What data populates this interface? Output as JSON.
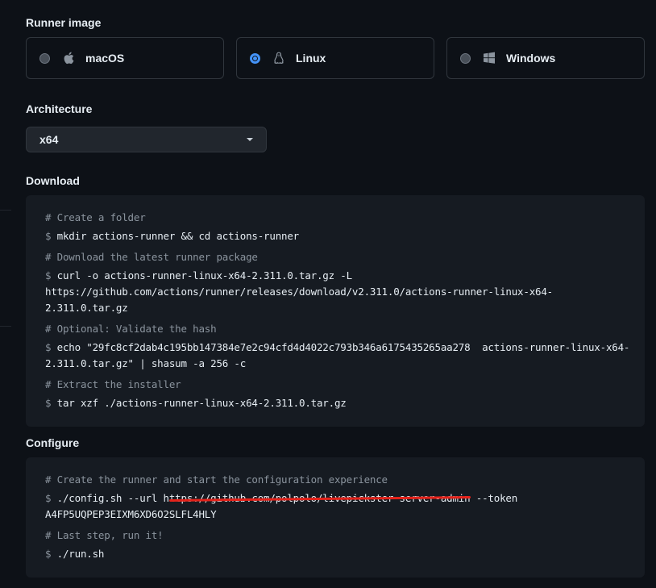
{
  "runner_image": {
    "title": "Runner image",
    "options": [
      {
        "label": "macOS",
        "icon": "apple-icon",
        "selected": false
      },
      {
        "label": "Linux",
        "icon": "linux-tux-icon",
        "selected": true
      },
      {
        "label": "Windows",
        "icon": "windows-icon",
        "selected": false
      }
    ]
  },
  "architecture": {
    "title": "Architecture",
    "selected": "x64"
  },
  "download": {
    "title": "Download",
    "prompt": "$",
    "lines": {
      "c1": "# Create a folder",
      "l1": "mkdir actions-runner && cd actions-runner",
      "c2": "# Download the latest runner package",
      "l2a": "curl -o actions-runner-linux-x64-2.311.0.tar.gz -L",
      "l2b": "https://github.com/actions/runner/releases/download/v2.311.0/actions-runner-linux-x64-",
      "l2c": "2.311.0.tar.gz",
      "c3": "# Optional: Validate the hash",
      "l3a": "echo \"29fc8cf2dab4c195bb147384e7e2c94cfd4d4022c793b346a6175435265aa278  actions-runner-linux-x64-",
      "l3b": "2.311.0.tar.gz\" | shasum -a 256 -c",
      "c4": "# Extract the installer",
      "l4": "tar xzf ./actions-runner-linux-x64-2.311.0.tar.gz"
    }
  },
  "configure": {
    "title": "Configure",
    "prompt": "$",
    "lines": {
      "c1": "# Create the runner and start the configuration experience",
      "l1a_pre": "./config.sh --url h",
      "l1a_redacted": "ttps://github.com/polpolo/livepickster-server-admin",
      "l1a_post": " --token",
      "l1b": "A4FP5UQPEP3EIXM6XD6O2SLFL4HLY",
      "c2": "# Last step, run it!",
      "l2": "./run.sh"
    }
  },
  "colors": {
    "background": "#0d1117",
    "code_background": "#161b22",
    "accent": "#4493f8",
    "redaction": "#e5221a"
  }
}
